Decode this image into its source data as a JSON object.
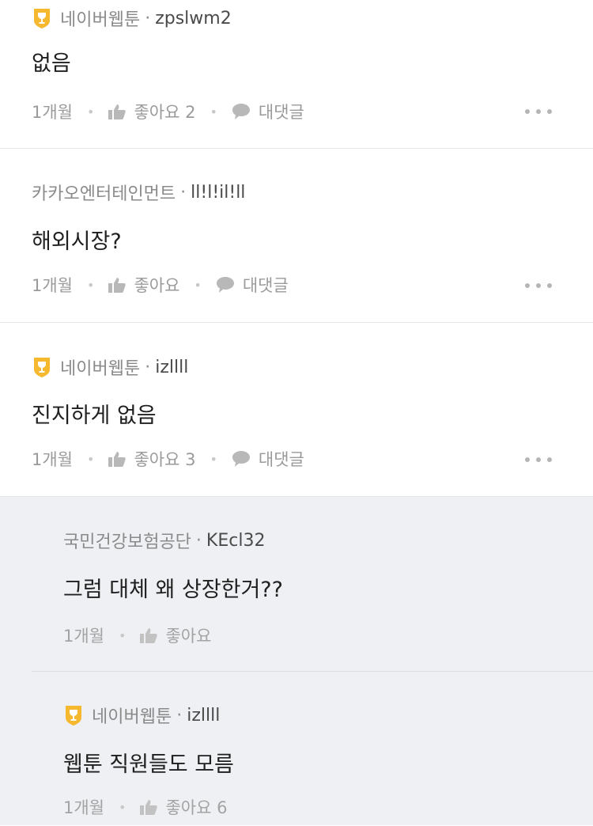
{
  "comments": [
    {
      "company": "네이버웹툰",
      "separator": "·",
      "nickname": "zpslwm2",
      "text": "없음",
      "time": "1개월",
      "like_label": "좋아요 2",
      "reply_label": "대댓글",
      "badge": "trophy-badge-icon"
    },
    {
      "company": "카카오엔터테인먼트",
      "separator": "·",
      "nickname": "ll!l!il!ll",
      "text": "해외시장?",
      "time": "1개월",
      "like_label": "좋아요",
      "reply_label": "대댓글"
    },
    {
      "company": "네이버웹툰",
      "separator": "·",
      "nickname": "izllll",
      "text": "진지하게 없음",
      "time": "1개월",
      "like_label": "좋아요 3",
      "reply_label": "대댓글",
      "badge": "trophy-badge-icon"
    }
  ],
  "replies": [
    {
      "company": "국민건강보험공단",
      "separator": "·",
      "nickname": "KEcl32",
      "text": "그럼 대체 왜 상장한거??",
      "time": "1개월",
      "like_label": "좋아요"
    },
    {
      "company": "네이버웹툰",
      "separator": "·",
      "nickname": "izllll",
      "text": "웹툰 직원들도 모름",
      "time": "1개월",
      "like_label": "좋아요 6",
      "badge": "trophy-badge-icon"
    }
  ],
  "colors": {
    "badge_yellow": "#f5b82e",
    "reply_background": "#eef0f3",
    "muted_text": "#9a9a9a"
  }
}
